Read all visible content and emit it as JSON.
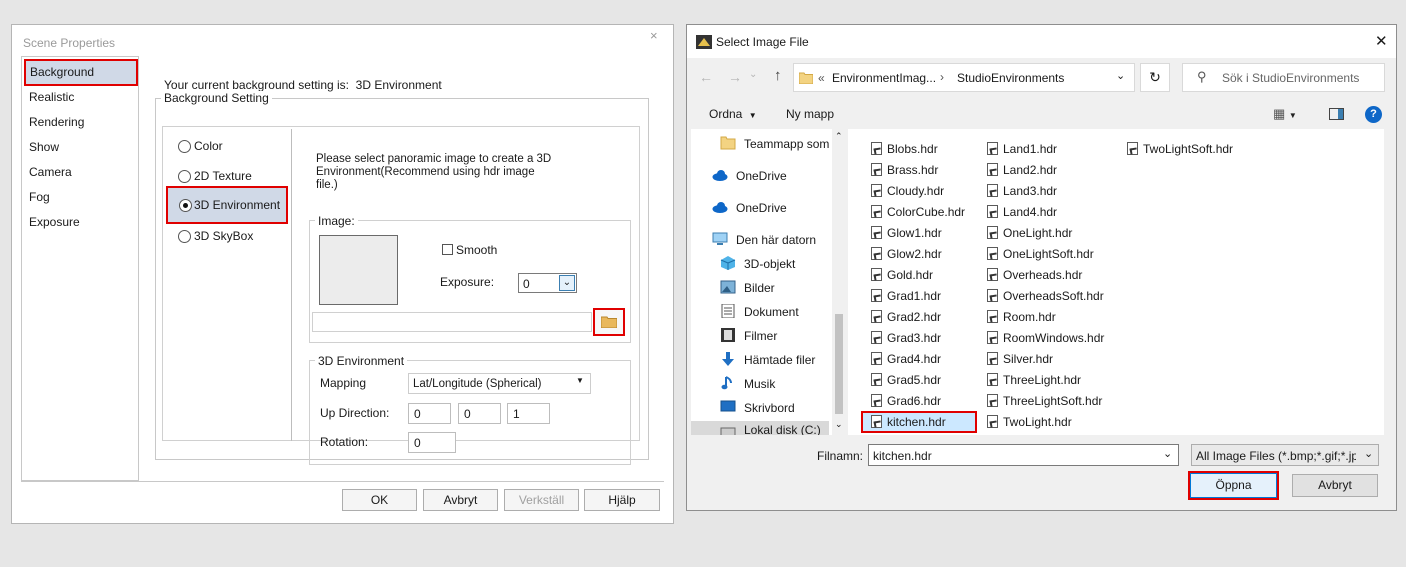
{
  "scene": {
    "title": "Scene Properties",
    "close": "×",
    "sidebar": [
      "Background",
      "Realistic",
      "Rendering",
      "Show",
      "Camera",
      "Fog",
      "Exposure"
    ],
    "current_setting_text": "Your current background setting is:",
    "current_setting_value": "3D Environment",
    "group_background": "Background Setting",
    "radios": [
      "Color",
      "2D Texture",
      "3D Environment",
      "3D SkyBox"
    ],
    "selected_radio": "3D Environment",
    "hint": "Please select panoramic image to create a 3D Environment(Recommend using hdr image file.)",
    "image_group": "Image:",
    "smooth_label": "Smooth",
    "exposure_label": "Exposure:",
    "exposure_value": "0",
    "env_group": "3D Environment",
    "mapping_label": "Mapping",
    "mapping_value": "Lat/Longitude (Spherical)",
    "up_label": "Up Direction:",
    "up_values": [
      "0",
      "0",
      "1"
    ],
    "rotation_label": "Rotation:",
    "rotation_value": "0",
    "buttons": {
      "ok": "OK",
      "cancel": "Avbryt",
      "apply": "Verkställ",
      "help": "Hjälp"
    }
  },
  "dialog": {
    "title": "Select Image File",
    "close": "✕",
    "breadcrumb_prefix": "«",
    "breadcrumb": [
      "EnvironmentImag...",
      "StudioEnvironments"
    ],
    "search_placeholder": "Sök i StudioEnvironments",
    "toolbar": {
      "organize": "Ordna",
      "new_folder": "Ny mapp"
    },
    "nav": [
      {
        "label": "Teammapp som",
        "icon": "folder-icon"
      },
      {
        "label": "OneDrive",
        "icon": "cloud-icon"
      },
      {
        "label": "OneDrive",
        "icon": "cloud-icon"
      },
      {
        "label": "Den här datorn",
        "icon": "computer-icon"
      },
      {
        "label": "3D-objekt",
        "icon": "cube-icon"
      },
      {
        "label": "Bilder",
        "icon": "pictures-icon"
      },
      {
        "label": "Dokument",
        "icon": "document-icon"
      },
      {
        "label": "Filmer",
        "icon": "film-icon"
      },
      {
        "label": "Hämtade filer",
        "icon": "download-icon"
      },
      {
        "label": "Musik",
        "icon": "music-icon"
      },
      {
        "label": "Skrivbord",
        "icon": "desktop-icon"
      },
      {
        "label": "Lokal disk (C:)",
        "icon": "drive-icon"
      }
    ],
    "files_col1": [
      "Blobs.hdr",
      "Brass.hdr",
      "Cloudy.hdr",
      "ColorCube.hdr",
      "Glow1.hdr",
      "Glow2.hdr",
      "Gold.hdr",
      "Grad1.hdr",
      "Grad2.hdr",
      "Grad3.hdr",
      "Grad4.hdr",
      "Grad5.hdr",
      "Grad6.hdr",
      "kitchen.hdr"
    ],
    "files_col2": [
      "Land1.hdr",
      "Land2.hdr",
      "Land3.hdr",
      "Land4.hdr",
      "OneLight.hdr",
      "OneLightSoft.hdr",
      "Overheads.hdr",
      "OverheadsSoft.hdr",
      "Room.hdr",
      "RoomWindows.hdr",
      "Silver.hdr",
      "ThreeLight.hdr",
      "ThreeLightSoft.hdr",
      "TwoLight.hdr"
    ],
    "files_col3": [
      "TwoLightSoft.hdr"
    ],
    "selected_file": "kitchen.hdr",
    "filename_label": "Filnamn:",
    "filename_value": "kitchen.hdr",
    "filter_value": "All Image Files (*.bmp;*.gif;*.jpg",
    "open_button": "Öppna",
    "cancel_button": "Avbryt",
    "colors": {
      "accent": "#0078d7",
      "highlight": "#e00000",
      "selection": "#cce8ff"
    }
  }
}
